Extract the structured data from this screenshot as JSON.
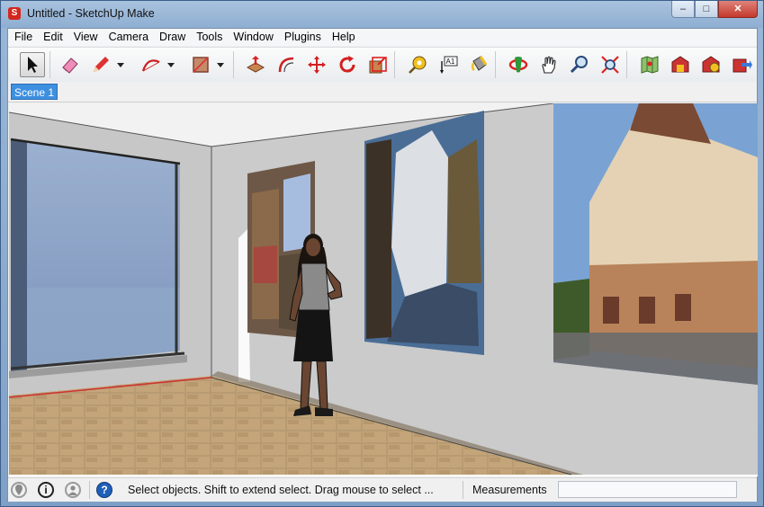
{
  "window": {
    "title": "Untitled - SketchUp Make",
    "controls": {
      "minimize": "–",
      "maximize": "□",
      "close": "✕"
    }
  },
  "menubar": {
    "items": [
      "File",
      "Edit",
      "View",
      "Camera",
      "Draw",
      "Tools",
      "Window",
      "Plugins",
      "Help"
    ]
  },
  "toolbar": {
    "tools": [
      {
        "name": "select-tool",
        "icon": "arrow-icon",
        "selected": true
      },
      {
        "name": "eraser-tool",
        "icon": "eraser-icon"
      },
      {
        "name": "line-tool",
        "icon": "pencil-icon",
        "has_dropdown": true
      },
      {
        "name": "arc-tool",
        "icon": "arc-icon",
        "has_dropdown": true
      },
      {
        "name": "rectangle-tool",
        "icon": "rectangle-icon",
        "has_dropdown": true
      },
      {
        "name": "push-pull-tool",
        "icon": "push-pull-icon"
      },
      {
        "name": "offset-tool",
        "icon": "offset-icon"
      },
      {
        "name": "move-tool",
        "icon": "move-icon"
      },
      {
        "name": "rotate-tool",
        "icon": "rotate-icon"
      },
      {
        "name": "scale-tool",
        "icon": "scale-icon"
      },
      {
        "name": "tape-measure-tool",
        "icon": "tape-measure-icon"
      },
      {
        "name": "text-tool",
        "icon": "text-icon",
        "label": "A1"
      },
      {
        "name": "paint-bucket-tool",
        "icon": "paint-bucket-icon"
      },
      {
        "name": "orbit-tool",
        "icon": "orbit-icon"
      },
      {
        "name": "pan-tool",
        "icon": "hand-icon"
      },
      {
        "name": "zoom-tool",
        "icon": "magnifier-icon"
      },
      {
        "name": "zoom-extents-tool",
        "icon": "zoom-extents-icon"
      },
      {
        "name": "add-location-tool",
        "icon": "map-icon"
      },
      {
        "name": "get-models-tool",
        "icon": "warehouse-icon"
      },
      {
        "name": "share-model-tool",
        "icon": "share-icon"
      },
      {
        "name": "extension-warehouse-tool",
        "icon": "extension-icon"
      }
    ]
  },
  "scenes": {
    "tabs": [
      "Scene 1"
    ]
  },
  "statusbar": {
    "icons": [
      "geo-location-icon",
      "credits-icon",
      "user-icon",
      "help-icon"
    ],
    "help_glyph": "?",
    "info_glyph": "i",
    "text": "Select objects. Shift to extend select. Drag mouse to select ...",
    "measurements_label": "Measurements",
    "measurements_value": ""
  },
  "colors": {
    "title_bar": "#8eaed2",
    "scene_tab": "#3d8fe0",
    "wall": "#c9c9c9",
    "floor": "#b79b72",
    "sky_window": "#8fa6c9"
  }
}
